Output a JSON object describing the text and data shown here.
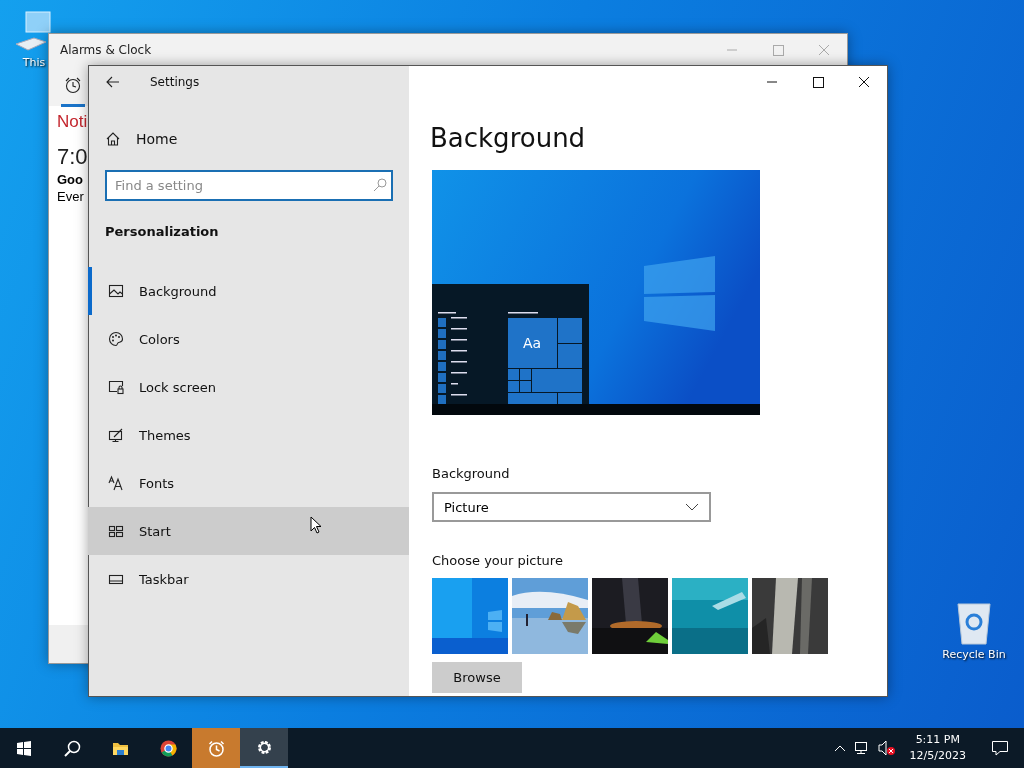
{
  "desktop_icons": [
    {
      "kind": "computer",
      "label": "This"
    },
    {
      "kind": "recycle",
      "label": "Recycle Bin"
    }
  ],
  "alarms_window": {
    "title": "Alarms & Clock",
    "heading": "Noti",
    "time": "7:0",
    "alarm_name": "Goo",
    "repeat": "Ever"
  },
  "settings_window": {
    "title": "Settings",
    "home": "Home",
    "search": {
      "placeholder": "Find a setting"
    },
    "section": "Personalization",
    "nav": [
      {
        "kind": "background",
        "label": "Background",
        "selected": true,
        "hovered": false
      },
      {
        "kind": "colors",
        "label": "Colors",
        "selected": false,
        "hovered": false
      },
      {
        "kind": "lock",
        "label": "Lock screen",
        "selected": false,
        "hovered": false
      },
      {
        "kind": "themes",
        "label": "Themes",
        "selected": false,
        "hovered": false
      },
      {
        "kind": "fonts",
        "label": "Fonts",
        "selected": false,
        "hovered": false
      },
      {
        "kind": "start",
        "label": "Start",
        "selected": false,
        "hovered": true
      },
      {
        "kind": "taskbar",
        "label": "Taskbar",
        "selected": false,
        "hovered": false
      }
    ],
    "page_title": "Background",
    "preview": {
      "tile_text": "Aa"
    },
    "background_label": "Background",
    "background_dropdown": {
      "value": "Picture"
    },
    "choose_label": "Choose your picture",
    "browse_button": "Browse"
  },
  "taskbar": {
    "apps": [
      {
        "kind": "start",
        "flashing": false,
        "active": false
      },
      {
        "kind": "search",
        "flashing": false,
        "active": false
      },
      {
        "kind": "explorer",
        "flashing": false,
        "active": false
      },
      {
        "kind": "chrome",
        "flashing": false,
        "active": false
      },
      {
        "kind": "alarms",
        "flashing": true,
        "active": false
      },
      {
        "kind": "settings",
        "flashing": false,
        "active": true
      }
    ],
    "time": "5:11 PM",
    "date": "12/5/2023"
  }
}
